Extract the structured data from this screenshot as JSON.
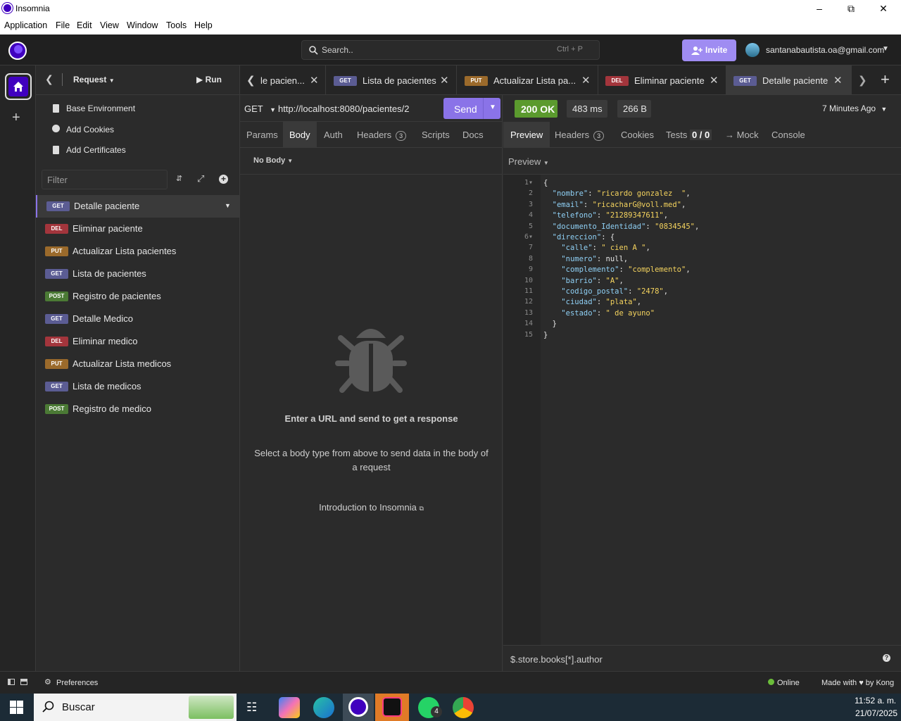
{
  "window": {
    "title": "Insomnia"
  },
  "menu": [
    "Application",
    "File",
    "Edit",
    "View",
    "Window",
    "Tools",
    "Help"
  ],
  "appbar": {
    "search_label": "Search..",
    "search_shortcut": "Ctrl + P",
    "invite_label": "Invite",
    "user_email": "santanabautista.oa@gmail.com"
  },
  "sidebar": {
    "header": "Request",
    "run_label": "Run",
    "links": [
      "Base Environment",
      "Add Cookies",
      "Add Certificates"
    ],
    "filter_placeholder": "Filter",
    "requests": [
      {
        "method": "GET",
        "name": "Detalle paciente"
      },
      {
        "method": "DEL",
        "name": "Eliminar paciente"
      },
      {
        "method": "PUT",
        "name": "Actualizar Lista pacientes"
      },
      {
        "method": "GET",
        "name": "Lista de pacientes"
      },
      {
        "method": "POST",
        "name": "Registro de pacientes"
      },
      {
        "method": "GET",
        "name": "Detalle Medico"
      },
      {
        "method": "DEL",
        "name": "Eliminar medico"
      },
      {
        "method": "PUT",
        "name": "Actualizar Lista medicos"
      },
      {
        "method": "GET",
        "name": "Lista de medicos"
      },
      {
        "method": "POST",
        "name": "Registro de medico"
      }
    ],
    "preferences": "Preferences"
  },
  "tabs": [
    {
      "method": "",
      "name": "le pacien..."
    },
    {
      "method": "GET",
      "name": "Lista de pacientes"
    },
    {
      "method": "PUT",
      "name": "Actualizar Lista pa..."
    },
    {
      "method": "DEL",
      "name": "Eliminar paciente"
    },
    {
      "method": "GET",
      "name": "Detalle paciente"
    }
  ],
  "request": {
    "method": "GET",
    "url": "http://localhost:8080/pacientes/2",
    "send_label": "Send",
    "subtabs": [
      "Params",
      "Body",
      "Auth",
      "Headers",
      "Scripts",
      "Docs"
    ],
    "headers_count": "3",
    "body_type": "No Body",
    "empty_title": "Enter a URL and send to get a response",
    "empty_desc": "Select a body type from above to send data in the body of a request",
    "intro_link": "Introduction to Insomnia"
  },
  "response": {
    "status": "200 OK",
    "time": "483 ms",
    "size": "266 B",
    "ago": "7 Minutes Ago",
    "subtabs": [
      "Preview",
      "Headers",
      "Cookies",
      "Tests",
      "→ Mock",
      "Console"
    ],
    "headers_count": "3",
    "tests_count": "0 / 0",
    "preview_label": "Preview",
    "lines": [
      "{",
      "  \"nombre\": \"ricardo gonzalez  \",",
      "  \"email\": \"ricacharG@voll.med\",",
      "  \"telefono\": \"21289347611\",",
      "  \"documento_Identidad\": \"0834545\",",
      "  \"direccion\": {",
      "    \"calle\": \" cien A \",",
      "    \"numero\": null,",
      "    \"complemento\": \"complemento\",",
      "    \"barrio\": \"A\",",
      "    \"codigo_postal\": \"2478\",",
      "    \"ciudad\": \"plata\",",
      "    \"estado\": \" de ayuno\"",
      "  }",
      "}"
    ],
    "filter_placeholder": "$.store.books[*].author"
  },
  "statusbar": {
    "online": "Online",
    "made_with": "Made with",
    "by": "by Kong"
  },
  "taskbar": {
    "search": "Buscar",
    "time": "11:52 a. m.",
    "date": "21/07/2025",
    "whatsapp_count": "4"
  },
  "colors": {
    "accent": "#8a73e8",
    "status_ok": "#5b9a2e",
    "get": "#5b5c93",
    "del": "#a3353c",
    "put": "#9b6a2b",
    "post": "#4b7a35"
  }
}
